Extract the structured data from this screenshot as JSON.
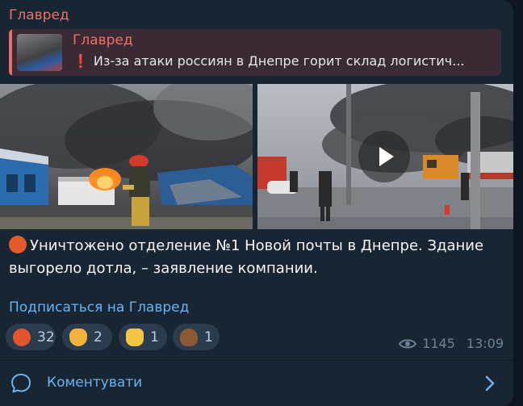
{
  "post": {
    "channel_name": "Главред",
    "reply": {
      "title": "Главред",
      "text": "Из-за атаки россиян в Днепре горит склад логистич..."
    },
    "message": "Уничтожено отделение №1 Новой почты в Днепре. Здание выгорело дотла, – заявление компании.",
    "subscribe_link": "Подписаться на Главред",
    "reactions": [
      {
        "emoji": "angry-face-icon",
        "count": "32"
      },
      {
        "emoji": "ok-hand-icon",
        "count": "2"
      },
      {
        "emoji": "thumbs-up-icon",
        "count": "1"
      },
      {
        "emoji": "pile-of-poo-icon",
        "count": "1"
      }
    ],
    "views": "1145",
    "time": "13:09"
  },
  "comments": {
    "label": "Коментувати"
  },
  "colors": {
    "background": "#0e1621",
    "bubble": "#182533",
    "accent_name": "#ef6f64",
    "link": "#6ab2f2",
    "reaction_bg": "#2b3c4e",
    "meta": "#6f8396"
  },
  "icons": {
    "reply_exclamation": "red-exclamation-icon",
    "message_emoji": "angry-face-icon",
    "views": "eye-icon",
    "comments": "chat-bubble-icon",
    "open": "chevron-right-icon",
    "video": "play-icon"
  }
}
